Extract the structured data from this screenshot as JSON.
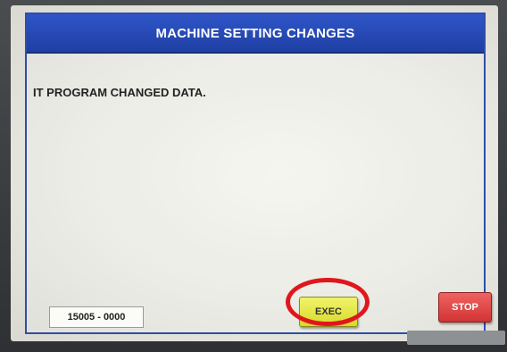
{
  "dialog": {
    "title": "MACHINE SETTING CHANGES",
    "message": "IT PROGRAM CHANGED DATA.",
    "code": "15005 - 0000"
  },
  "buttons": {
    "exec_label": "EXEC",
    "stop_label": "STOP"
  },
  "colors": {
    "title_bar": "#2347b8",
    "exec": "#e4e63e",
    "stop": "#e04848",
    "highlight_ring": "#e1161c"
  }
}
